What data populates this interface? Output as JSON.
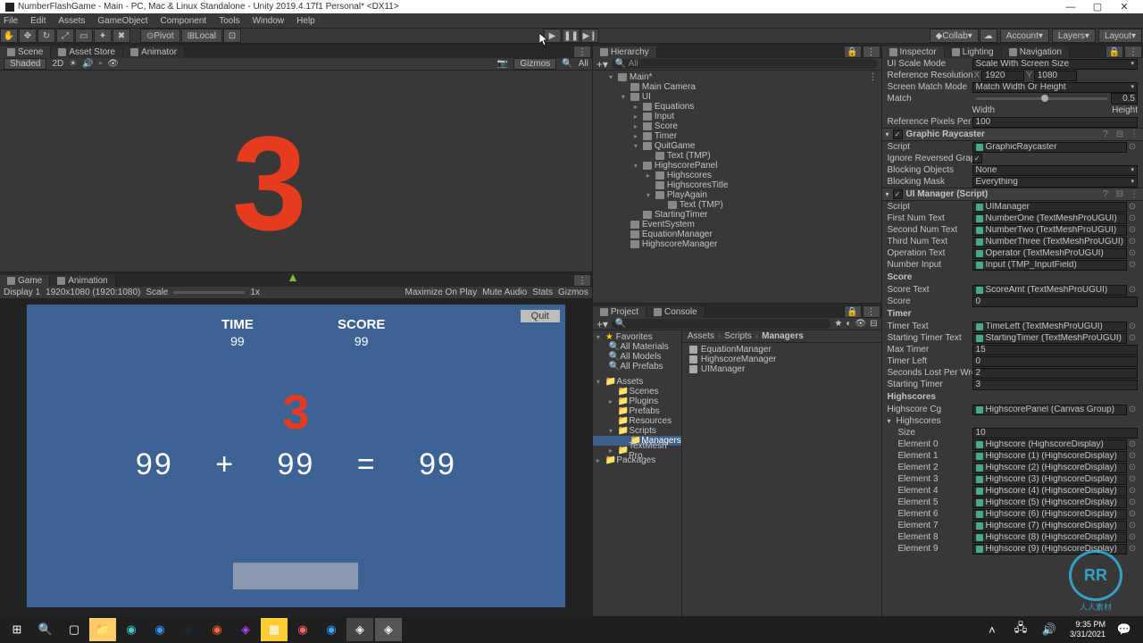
{
  "title": "NumberFlashGame - Main - PC, Mac & Linux Standalone - Unity 2019.4.17f1 Personal* <DX11>",
  "menu": [
    "File",
    "Edit",
    "Assets",
    "GameObject",
    "Component",
    "Tools",
    "Window",
    "Help"
  ],
  "toolbar": {
    "pivot": "Pivot",
    "local": "Local",
    "collab": "Collab",
    "account": "Account",
    "layers": "Layers",
    "layout": "Layout"
  },
  "scene_tabs": {
    "scene": "Scene",
    "asset_store": "Asset Store",
    "animator": "Animator"
  },
  "scene_toolbar": {
    "shaded": "Shaded",
    "twod": "2D",
    "gizmos": "Gizmos",
    "all": "All"
  },
  "scene_content": {
    "big_number": "3"
  },
  "game_tabs": {
    "game": "Game",
    "animation": "Animation"
  },
  "game_toolbar": {
    "display": "Display 1",
    "resolution": "1920x1080 (1920:1080)",
    "scale_label": "Scale",
    "scale_value": "1x",
    "maximize": "Maximize On Play",
    "mute": "Mute Audio",
    "stats": "Stats",
    "gizmos": "Gizmos"
  },
  "game": {
    "quit": "Quit",
    "time_label": "TIME",
    "time_value": "99",
    "score_label": "SCORE",
    "score_value": "99",
    "starting_timer": "3",
    "num1": "99",
    "op": "+",
    "num2": "99",
    "eq": "=",
    "num3": "99"
  },
  "hierarchy_tab": "Hierarchy",
  "hierarchy_search": "All",
  "hierarchy": {
    "root": "Main*",
    "items": [
      "Main Camera",
      "UI",
      "Equations",
      "Input",
      "Score",
      "Timer",
      "QuitGame",
      "Text (TMP)",
      "HighscorePanel",
      "Highscores",
      "HighscoresTitle",
      "PlayAgain",
      "Text (TMP)",
      "StartingTimer",
      "EventSystem",
      "EquationManager",
      "HighscoreManager"
    ]
  },
  "project_tab": "Project",
  "console_tab": "Console",
  "project": {
    "favorites": "Favorites",
    "fav_items": [
      "All Materials",
      "All Models",
      "All Prefabs"
    ],
    "assets": "Assets",
    "folders": [
      "Scenes",
      "Plugins",
      "Prefabs",
      "Resources",
      "Scripts",
      "Managers",
      "TextMesh Pro"
    ],
    "packages": "Packages",
    "breadcrumb": [
      "Assets",
      "Scripts",
      "Managers"
    ],
    "files": [
      "EquationManager",
      "HighscoreManager",
      "UIManager"
    ]
  },
  "inspector_tabs": {
    "inspector": "Inspector",
    "lighting": "Lighting",
    "navigation": "Navigation"
  },
  "inspector": {
    "ui_scale": "UI Scale Mode",
    "scale_with_screen": "Scale With Screen Size",
    "ref_res_label": "Reference Resolution",
    "ref_res_x": "1920",
    "ref_res_y": "1080",
    "match_mode_label": "Screen Match Mode",
    "match_mode_val": "Match Width Or Height",
    "match_label": "Match",
    "match_val": "0.5",
    "width": "Width",
    "height": "Height",
    "ref_pixels_label": "Reference Pixels Per Unit",
    "ref_pixels_val": "100",
    "graphic_raycaster": "Graphic Raycaster",
    "script": "Script",
    "gr_script": "GraphicRaycaster",
    "ignore_rev_label": "Ignore Reversed Graphics",
    "blocking_obj_label": "Blocking Objects",
    "blocking_obj_val": "None",
    "blocking_mask_label": "Blocking Mask",
    "blocking_mask_val": "Everything",
    "uimanager_title": "UI Manager (Script)",
    "uim_script": "UIManager",
    "first_num": "First Num Text",
    "first_num_val": "NumberOne (TextMeshProUGUI)",
    "second_num": "Second Num Text",
    "second_num_val": "NumberTwo (TextMeshProUGUI)",
    "third_num": "Third Num Text",
    "third_num_val": "NumberThree (TextMeshProUGUI)",
    "operation": "Operation Text",
    "operation_val": "Operator (TextMeshProUGUI)",
    "number_input": "Number Input",
    "number_input_val": "Input (TMP_InputField)",
    "score_section": "Score",
    "score_text": "Score Text",
    "score_text_val": "ScoreAmt (TextMeshProUGUI)",
    "score_val_label": "Score",
    "score_val": "0",
    "timer_section": "Timer",
    "timer_text": "Timer Text",
    "timer_text_val": "TimeLeft (TextMeshProUGUI)",
    "starting_timer_text": "Starting Timer Text",
    "starting_timer_text_val": "StartingTimer (TextMeshProUGUI)",
    "max_timer": "Max Timer",
    "max_timer_val": "15",
    "timer_left": "Timer Left",
    "timer_left_val": "0",
    "seconds_lost": "Seconds Lost Per Wrong",
    "seconds_lost_val": "2",
    "starting_timer_lbl": "Starting Timer",
    "starting_timer_val": "3",
    "highscores_section": "Highscores",
    "highscore_cg": "Highscore Cg",
    "highscore_cg_val": "HighscorePanel (Canvas Group)",
    "highscores_label": "Highscores",
    "size_label": "Size",
    "size_val": "10",
    "element_label": "Element",
    "element_val": "Highscore",
    "highscore_display": "HighscoreDisplay"
  },
  "taskbar": {
    "time": "9:35 PM",
    "date": "3/31/2021"
  },
  "watermark": "人人素材"
}
